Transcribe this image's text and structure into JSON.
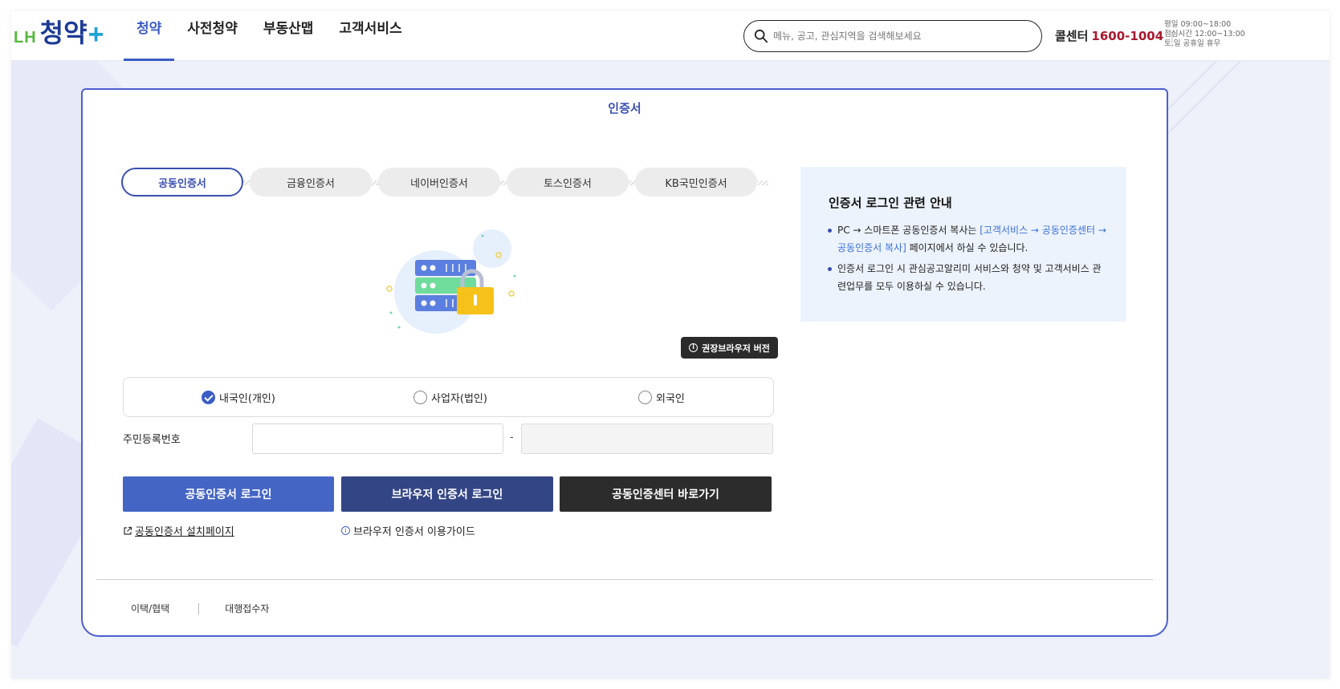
{
  "header": {
    "logo_lh": "LH",
    "logo_main": "청약",
    "logo_plus": "+",
    "nav": [
      {
        "label": "청약",
        "active": true
      },
      {
        "label": "사전청약",
        "active": false
      },
      {
        "label": "부동산맵",
        "active": false
      },
      {
        "label": "고객서비스",
        "active": false
      }
    ],
    "search_placeholder": "메뉴, 공고, 관심지역을 검색해보세요",
    "callcenter_label": "콜센터",
    "callcenter_number": "1600-1004",
    "hours": [
      "평일 09:00~18:00",
      "점심시간 12:00~13:00",
      "토,일 공휴일 휴무"
    ]
  },
  "card": {
    "title": "인증서",
    "tabs": [
      {
        "label": "공동인증서",
        "active": true
      },
      {
        "label": "금융인증서",
        "active": false
      },
      {
        "label": "네이버인증서",
        "active": false
      },
      {
        "label": "토스인증서",
        "active": false
      },
      {
        "label": "KB국민인증서",
        "active": false
      }
    ],
    "browser_version_button": "권장브라우저 버전",
    "user_types": [
      {
        "label": "내국인(개인)",
        "checked": true
      },
      {
        "label": "사업자(법인)",
        "checked": false
      },
      {
        "label": "외국인",
        "checked": false
      }
    ],
    "id_label": "주민등록번호",
    "id_separator": "-",
    "buttons": {
      "cert_login": "공동인증서 로그인",
      "browser_login": "브라우저 인증서 로그인",
      "cert_center": "공동인증센터 바로가기"
    },
    "links": {
      "install_page": "공동인증서 설치페이지",
      "browser_guide": "브라우저 인증서 이용가이드"
    },
    "info": {
      "title": "인증서 로그인 관련 안내",
      "item1_pre": "PC → 스마트폰 공동인증서 복사는 ",
      "item1_hl": "[고객서비스 → 공동인증센터 → 공동인증서 복사]",
      "item1_post": " 페이지에서 하실 수 있습니다.",
      "item2": "인증서 로그인 시 관심공고알리미 서비스와 청약 및 고객서비스 관련업무를 모두 이용하실 수 있습니다."
    },
    "footer_links": [
      "이택/협택",
      "대행접수자"
    ]
  },
  "colors": {
    "accent": "#3b5cc4",
    "navy_button": "#334584",
    "dark_button": "#2c2c2c",
    "callcenter_number": "#a8192e",
    "info_bg": "#edf3fc"
  }
}
